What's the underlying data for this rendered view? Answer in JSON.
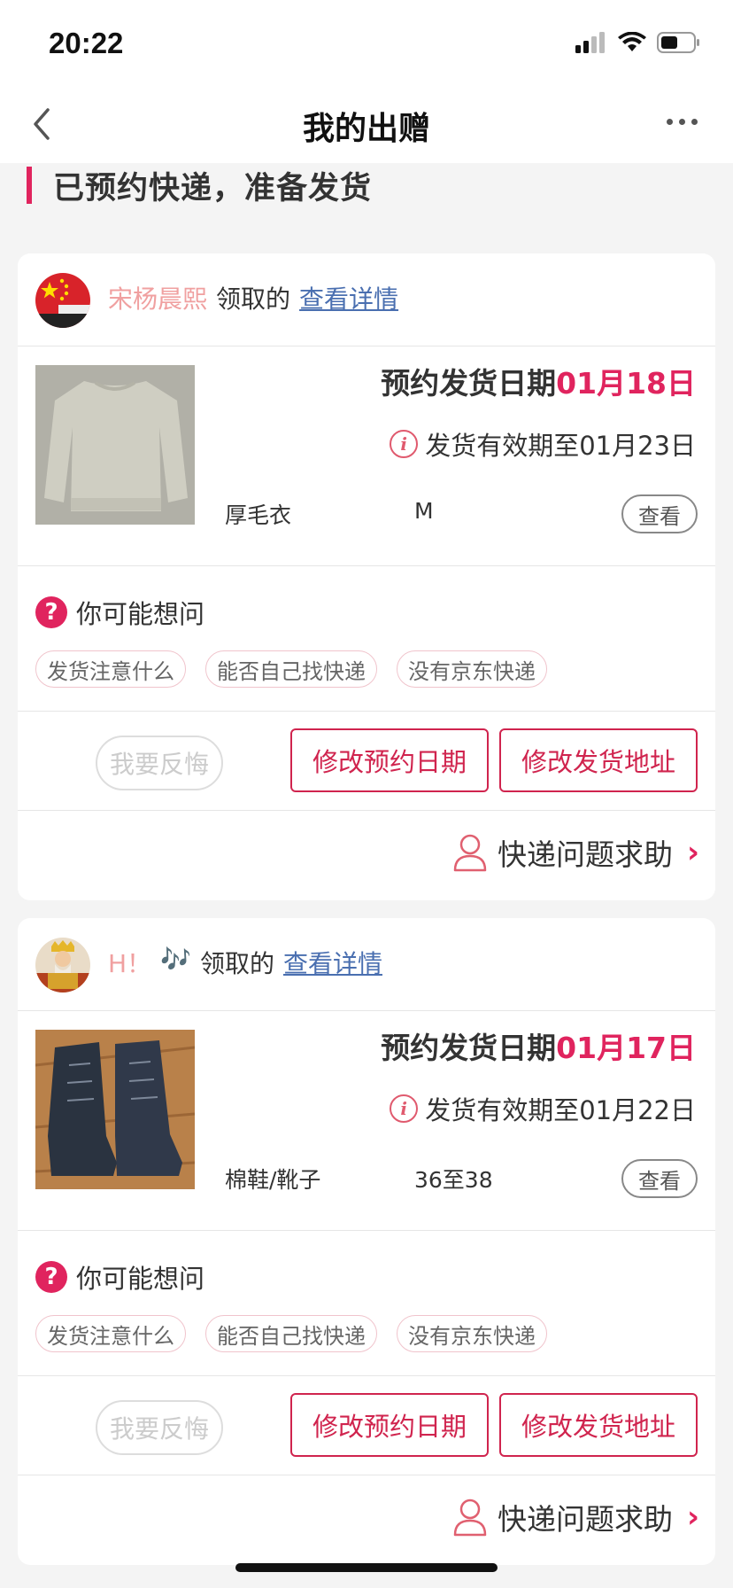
{
  "status_bar": {
    "time": "20:22"
  },
  "nav": {
    "title": "我的出赠"
  },
  "status_heading": "已预约快递，准备发货",
  "cards": [
    {
      "giver_name": "宋杨晨熙",
      "action_text": "领取的",
      "detail_link": "查看详情",
      "ship_date_label": "预约发货日期",
      "ship_date": "01月18日",
      "valid_text": "发货有效期至01月23日",
      "item_name": "厚毛衣",
      "item_size": "M",
      "view_label": "查看",
      "faq_title": "你可能想问",
      "tags": [
        "发货注意什么",
        "能否自己找快递",
        "没有京东快递"
      ],
      "regret_label": "我要反悔",
      "modify_date_label": "修改预约日期",
      "modify_address_label": "修改发货地址",
      "help_label": "快递问题求助"
    },
    {
      "giver_name": "H！",
      "giver_emoji": "🎶",
      "action_text": "领取的",
      "detail_link": "查看详情",
      "ship_date_label": "预约发货日期",
      "ship_date": "01月17日",
      "valid_text": "发货有效期至01月22日",
      "item_name": "棉鞋/靴子",
      "item_size": "36至38",
      "view_label": "查看",
      "faq_title": "你可能想问",
      "tags": [
        "发货注意什么",
        "能否自己找快递",
        "没有京东快递"
      ],
      "regret_label": "我要反悔",
      "modify_date_label": "修改预约日期",
      "modify_address_label": "修改发货地址",
      "help_label": "快递问题求助"
    }
  ],
  "colors": {
    "accent": "#e0245e",
    "link": "#4a6fb0",
    "giver_name": "#f0a0a0"
  }
}
